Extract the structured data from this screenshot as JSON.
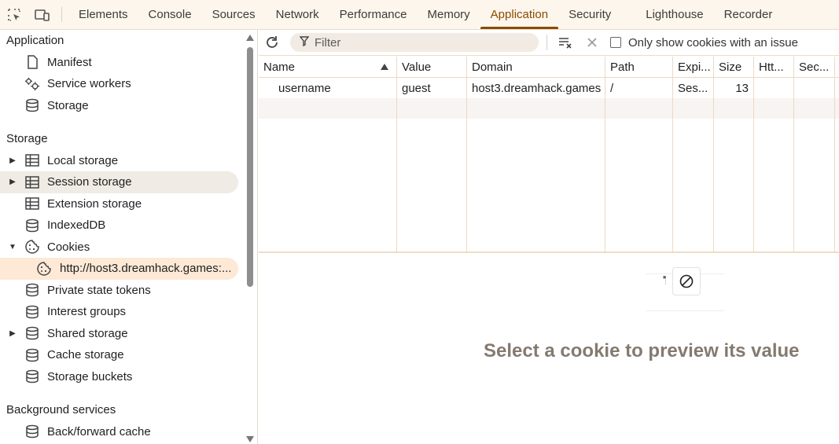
{
  "tabs": [
    "Elements",
    "Console",
    "Sources",
    "Network",
    "Performance",
    "Memory",
    "Application",
    "Security",
    "Lighthouse",
    "Recorder"
  ],
  "active_tab": "Application",
  "sidebar": {
    "sections": {
      "application": "Application",
      "storage": "Storage",
      "background": "Background services"
    },
    "application_items": [
      "Manifest",
      "Service workers",
      "Storage"
    ],
    "storage_items": {
      "local_storage": "Local storage",
      "session_storage": "Session storage",
      "extension_storage": "Extension storage",
      "indexeddb": "IndexedDB",
      "cookies": "Cookies",
      "cookie_origin": "http://host3.dreamhack.games:...",
      "private_state_tokens": "Private state tokens",
      "interest_groups": "Interest groups",
      "shared_storage": "Shared storage",
      "cache_storage": "Cache storage",
      "storage_buckets": "Storage buckets"
    },
    "background_items": [
      "Back/forward cache"
    ]
  },
  "toolbar": {
    "filter_placeholder": "Filter",
    "only_issue_label": "Only show cookies with an issue"
  },
  "table": {
    "columns": [
      "Name",
      "Value",
      "Domain",
      "Path",
      "Expi...",
      "Size",
      "Htt...",
      "Sec..."
    ],
    "rows": [
      [
        "username",
        "guest",
        "host3.dreamhack.games",
        "/",
        "Ses...",
        "13",
        "",
        ""
      ]
    ]
  },
  "preview": {
    "message": "Select a cookie to preview its value"
  },
  "colors": {
    "accent": "#8a4b00",
    "selected_bg": "#fde9d6",
    "tabbar_bg": "#fdf6ec"
  }
}
